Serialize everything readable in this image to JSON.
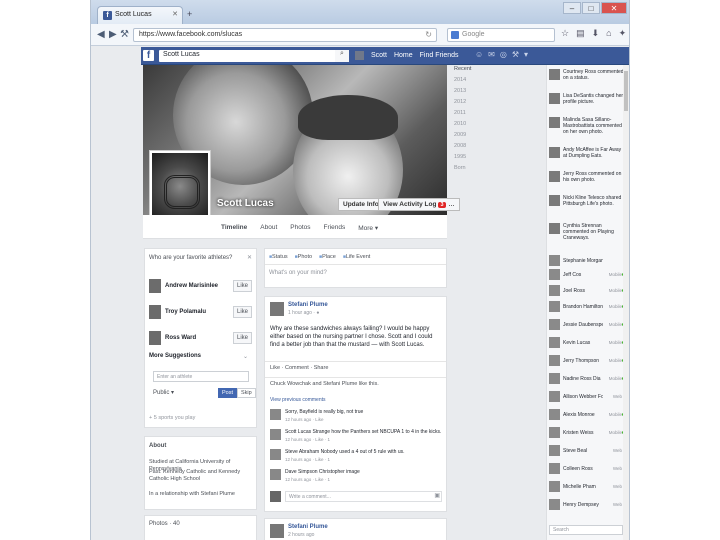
{
  "browser": {
    "tab_title": "Scott Lucas",
    "url": "https://www.facebook.com/slucas",
    "search_placeholder": "Google"
  },
  "fb_header": {
    "search_value": "Scott Lucas",
    "nav": [
      "Scott",
      "Home",
      "Find Friends"
    ]
  },
  "profile": {
    "name": "Scott Lucas",
    "update_info": "Update Info",
    "activity_log": "View Activity Log",
    "activity_badge": "3",
    "tabs": [
      "Timeline",
      "About",
      "Photos",
      "Friends",
      "More ▾"
    ]
  },
  "years": [
    "Recent",
    "2014",
    "2013",
    "2012",
    "2011",
    "2010",
    "2009",
    "2008",
    "1995",
    "Born"
  ],
  "pymk": {
    "header": "Who are your favorite athletes?",
    "people": [
      {
        "name": "Andrew Marisinlee",
        "like": "Like"
      },
      {
        "name": "Troy Polamalu",
        "like": "Like"
      },
      {
        "name": "Ross Ward",
        "like": "Like"
      }
    ],
    "more_suggestions": "More Suggestions",
    "input_placeholder": "Enter an athlete",
    "privacy": "Public ▾",
    "post": "Post",
    "skip": "Skip",
    "footer": "+ 5 sports you play"
  },
  "about": {
    "header": "About",
    "line1": "Studied at California University of Pennsylvania",
    "line2": "Past: Kennedy Catholic and Kennedy Catholic High School",
    "line3": "In a relationship with Stefani Plume"
  },
  "photos": {
    "header": "Photos · 40"
  },
  "composer": {
    "tabs": [
      "Status",
      "Photo",
      "Place",
      "Life Event"
    ],
    "placeholder": "What's on your mind?"
  },
  "post": {
    "author": "Stefani Plume",
    "time": "1 hour ago · ●",
    "text": "Why are these sandwiches always failing? I would be happy either based on the nursing partner I chose. Scott and I could find a better job than that the mustard — with Scott Lucas.",
    "actions": "Like · Comment · Share",
    "likes": "Chuck Wowchak and Stefani Plume like this.",
    "view_previous": "View previous comments",
    "comments": [
      {
        "text": "Sorry, Bayfield is really big, not true",
        "time": "12 hours ago · Like"
      },
      {
        "text": "Scott Lucas Strange how the Panthers set NBCUPA 1 to 4 in the kicks.",
        "time": "12 hours ago · Like · 1"
      },
      {
        "text": "Steve Abraham Nobody used a 4 out of 5 rule with us.",
        "time": "12 hours ago · Like · 1"
      },
      {
        "text": "Dave Simpson Christopher image",
        "time": "12 hours ago · Like · 1"
      }
    ],
    "write_comment": "Write a comment..."
  },
  "post2": {
    "author": "Stefani Plume",
    "time": "2 hours ago"
  },
  "ticker": [
    "Courtney Ross commented on a status.",
    "Lisa DeSantis changed her profile picture.",
    "Malinda Sasa Sillano-Mastrobattista commented on her own photo.",
    "Andy McAffee is Far Away at Dumpling Eats.",
    "Jerry Ross commented on his own photo.",
    "Nicki Kline Telesco shared Pittsburgh Life's photo.",
    "Cynthia Strennan commented on Playing Craneways."
  ],
  "chat": [
    {
      "name": "Stephanie Morgan",
      "status": ""
    },
    {
      "name": "Jeff Cos",
      "status": "Mobile"
    },
    {
      "name": "Joel Ross",
      "status": "Mobile"
    },
    {
      "name": "Brandon Hamilton",
      "status": "Mobile"
    },
    {
      "name": "Jessie Daubenspeck",
      "status": "Mobile"
    },
    {
      "name": "Kevin Lucas",
      "status": "Mobile"
    },
    {
      "name": "Jerry Thompson",
      "status": "Mobile"
    },
    {
      "name": "Nadine Ross Dia",
      "status": "Mobile"
    },
    {
      "name": "Allison Webber Fox",
      "status": "Web"
    },
    {
      "name": "Alexis Monroe",
      "status": "Mobile"
    },
    {
      "name": "Kristen Weiss",
      "status": "Mobile"
    },
    {
      "name": "Steve Beal",
      "status": "Web"
    },
    {
      "name": "Colleen Ross",
      "status": "Web"
    },
    {
      "name": "Michelle Pham",
      "status": "Web"
    },
    {
      "name": "Henry Dempsey",
      "status": "Web"
    }
  ],
  "chat_search": "Search",
  "colors": {
    "fb_blue": "#3b5998",
    "online": "#42b72a"
  }
}
